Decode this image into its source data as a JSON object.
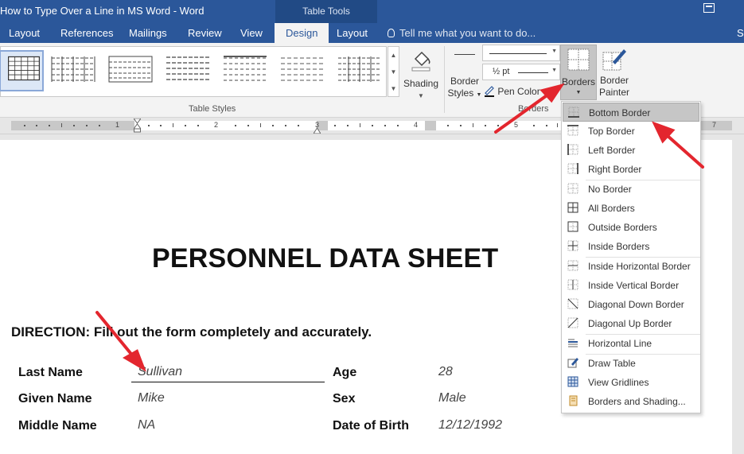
{
  "window": {
    "title": "How to Type Over a Line in MS Word - Word",
    "contextual_tab": "Table Tools"
  },
  "tabs": [
    {
      "label": "Layout",
      "active": false
    },
    {
      "label": "References",
      "active": false
    },
    {
      "label": "Mailings",
      "active": false
    },
    {
      "label": "Review",
      "active": false
    },
    {
      "label": "View",
      "active": false
    },
    {
      "label": "Design",
      "active": true
    },
    {
      "label": "Layout",
      "active": false
    }
  ],
  "tell_me": "Tell me what you want to do...",
  "signin_partial": "S",
  "ribbon": {
    "table_styles_label": "Table Styles",
    "shading_label": "Shading",
    "border_styles_line1": "Border",
    "border_styles_line2": "Styles",
    "pen_weight": "½ pt",
    "pen_color": "Pen Color",
    "borders_group_label": "Borders",
    "borders_button": "Borders",
    "border_painter_line1": "Border",
    "border_painter_line2": "Painter"
  },
  "ruler": {
    "numbers": [
      "1",
      "2",
      "3",
      "4",
      "5",
      "7"
    ]
  },
  "document": {
    "title": "PERSONNEL DATA SHEET",
    "direction": "DIRECTION: Fill out the form completely and accurately.",
    "fields_left": [
      {
        "label": "Last Name",
        "value": "Sullivan"
      },
      {
        "label": "Given Name",
        "value": "Mike"
      },
      {
        "label": "Middle Name",
        "value": "NA"
      }
    ],
    "fields_right": [
      {
        "label": "Age",
        "value": "28"
      },
      {
        "label": "Sex",
        "value": "Male"
      },
      {
        "label": "Date of Birth",
        "value": "12/12/1992"
      }
    ]
  },
  "borders_menu": {
    "items": [
      {
        "label": "Bottom Border",
        "icon": "bottom-border-icon",
        "highlighted": true
      },
      {
        "label": "Top Border",
        "icon": "top-border-icon"
      },
      {
        "label": "Left Border",
        "icon": "left-border-icon"
      },
      {
        "label": "Right Border",
        "icon": "right-border-icon"
      },
      {
        "label": "No Border",
        "icon": "no-border-icon"
      },
      {
        "label": "All Borders",
        "icon": "all-borders-icon"
      },
      {
        "label": "Outside Borders",
        "icon": "outside-borders-icon"
      },
      {
        "label": "Inside Borders",
        "icon": "inside-borders-icon"
      },
      {
        "label": "Inside Horizontal Border",
        "icon": "inside-horizontal-border-icon"
      },
      {
        "label": "Inside Vertical Border",
        "icon": "inside-vertical-border-icon"
      },
      {
        "label": "Diagonal Down Border",
        "icon": "diagonal-down-border-icon"
      },
      {
        "label": "Diagonal Up Border",
        "icon": "diagonal-up-border-icon"
      },
      {
        "label": "Horizontal Line",
        "icon": "horizontal-line-icon"
      },
      {
        "label": "Draw Table",
        "icon": "draw-table-icon"
      },
      {
        "label": "View Gridlines",
        "icon": "view-gridlines-icon"
      },
      {
        "label": "Borders and Shading...",
        "icon": "borders-and-shading-icon"
      }
    ]
  },
  "colors": {
    "brand_blue": "#2b579a",
    "annotation_red": "#e3262e",
    "menu_highlight": "#c6c6c6"
  }
}
